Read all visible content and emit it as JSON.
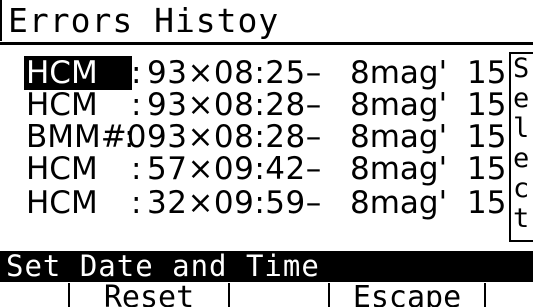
{
  "screen": {
    "title": "Errors Histoy",
    "rows": [
      {
        "source": "HCM",
        "colon": ":",
        "time": "93×08:25–",
        "date": "8mag'",
        "year": "15"
      },
      {
        "source": "HCM",
        "colon": ":",
        "time": "93×08:28–",
        "date": "8mag'",
        "year": "15"
      },
      {
        "source": "BMM#0",
        "colon": ":",
        "time": "93×08:28–",
        "date": "8mag'",
        "year": "15"
      },
      {
        "source": "HCM",
        "colon": ":",
        "time": "57×09:42–",
        "date": "8mag'",
        "year": "15"
      },
      {
        "source": "HCM",
        "colon": ":",
        "time": "32×09:59–",
        "date": "8mag'",
        "year": "15"
      }
    ],
    "side_panel": [
      "S",
      "e",
      "l",
      "e",
      "c",
      "t"
    ],
    "status_text": "Set Date and Time",
    "softkeys": [
      "",
      "Reset",
      "",
      "Escape",
      ""
    ]
  }
}
